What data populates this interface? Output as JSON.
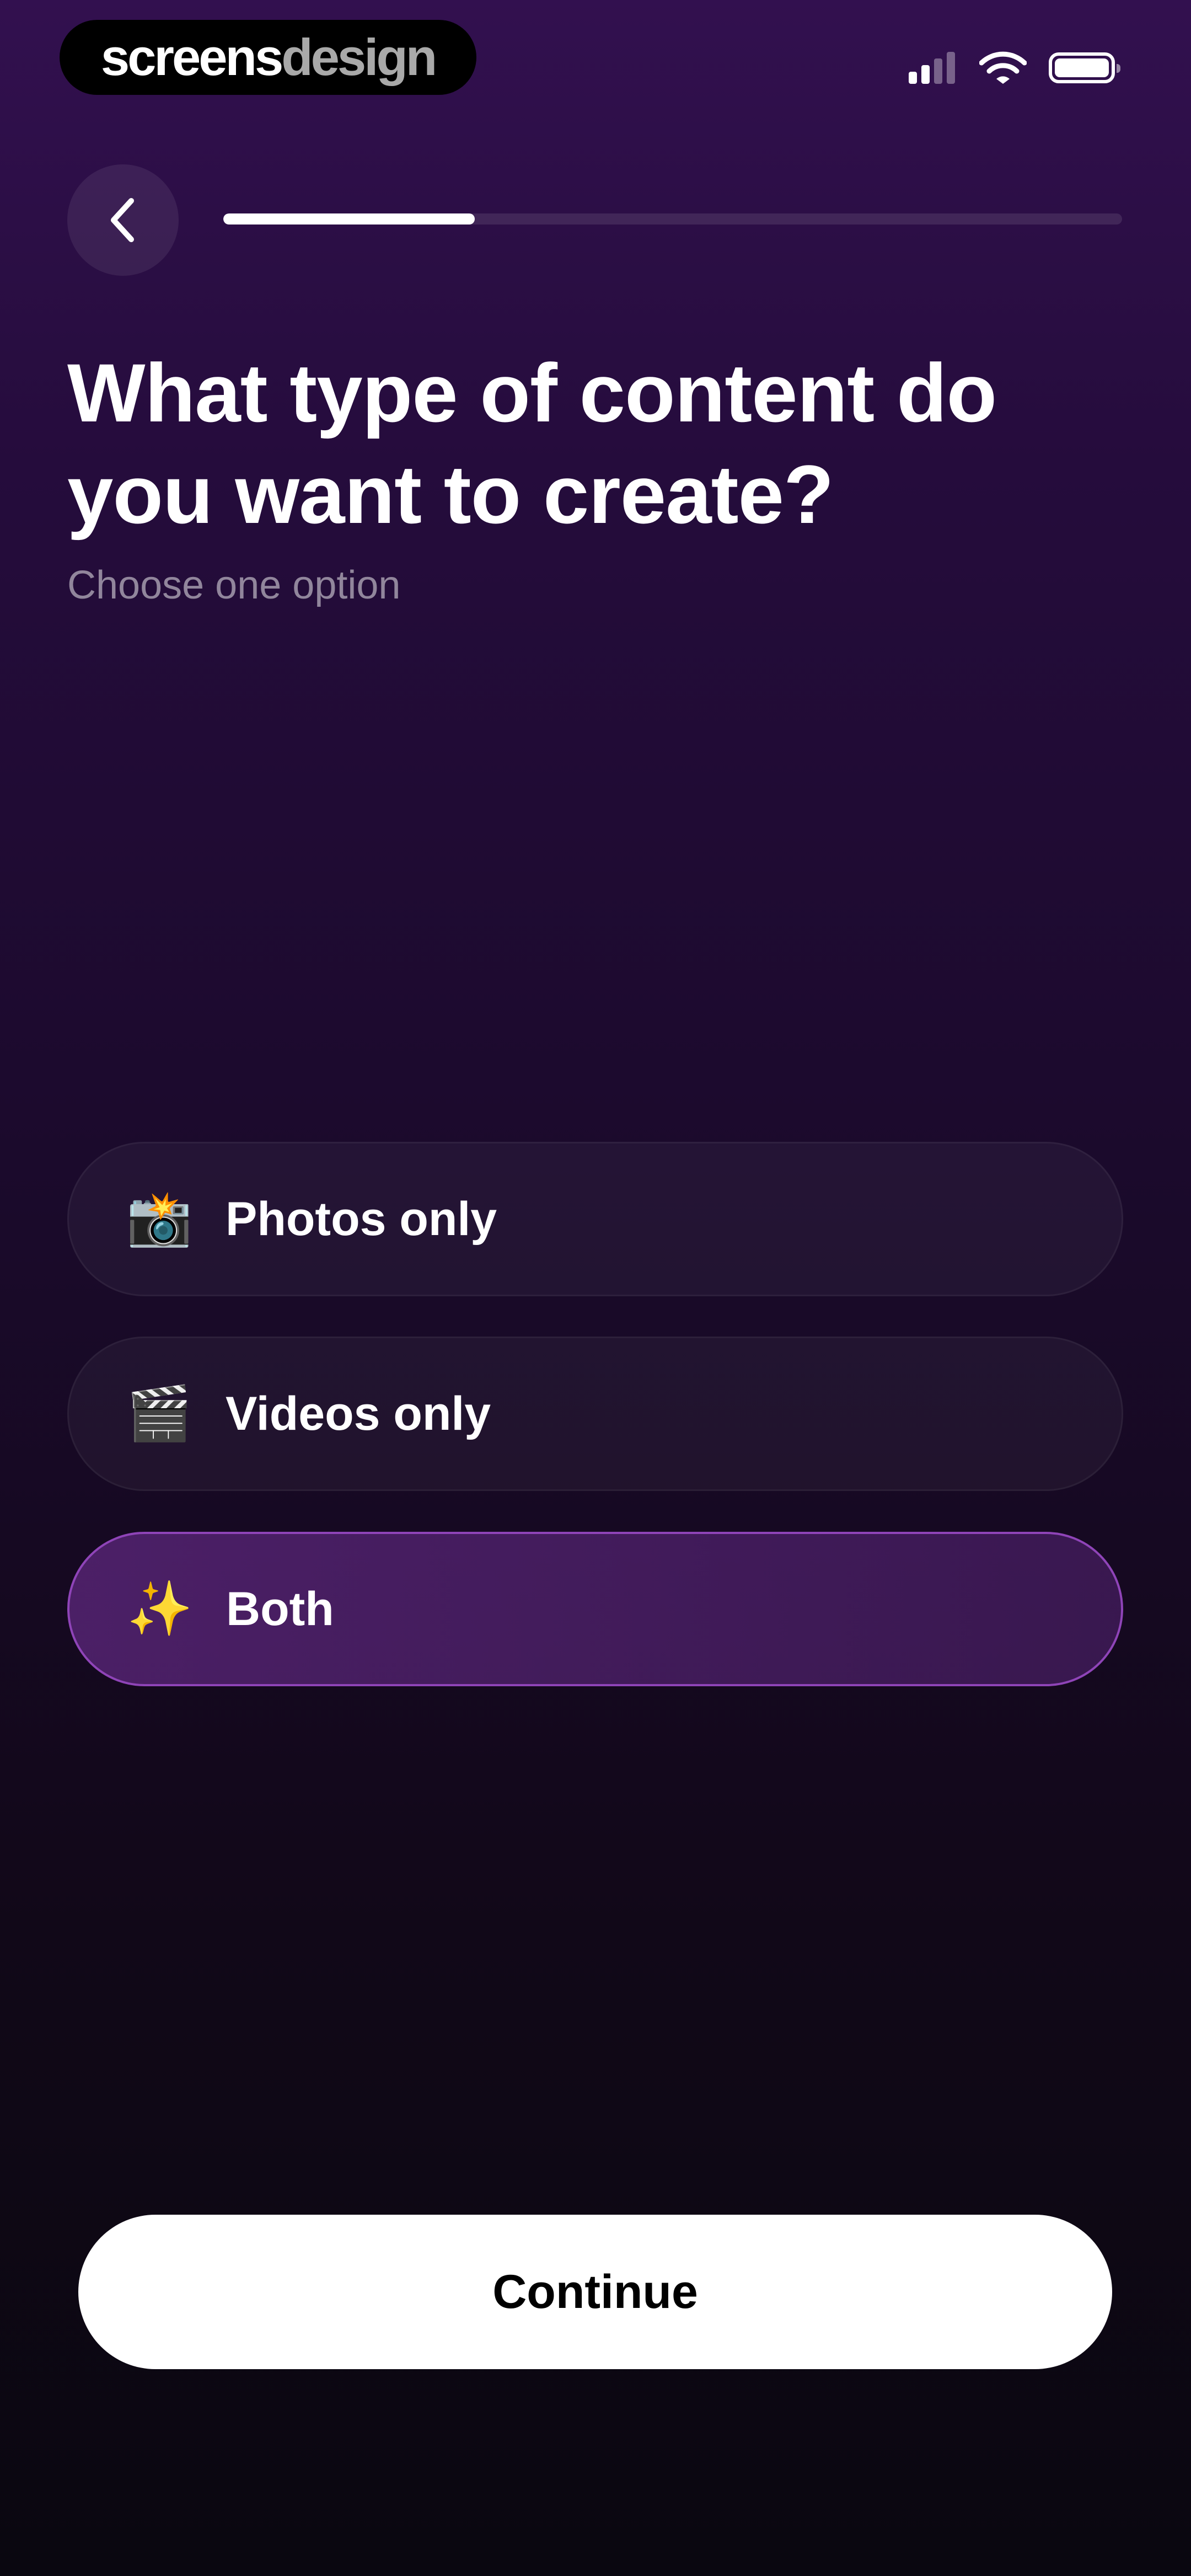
{
  "watermark": {
    "part1": "screens",
    "part2": "design"
  },
  "status_bar": {
    "signal_icon": "cellular-signal-icon",
    "wifi_icon": "wifi-icon",
    "battery_icon": "battery-icon"
  },
  "nav": {
    "back_icon": "chevron-left-icon",
    "progress_fraction": 0.28
  },
  "header": {
    "title": "What type of content do you want to create?",
    "subtitle": "Choose one option"
  },
  "options": [
    {
      "emoji": "📸",
      "icon": "camera-flash-icon",
      "label": "Photos only",
      "selected": false
    },
    {
      "emoji": "🎬",
      "icon": "clapper-board-icon",
      "label": "Videos only",
      "selected": false
    },
    {
      "emoji": "✨",
      "icon": "sparkles-icon",
      "label": "Both",
      "selected": true
    }
  ],
  "footer": {
    "continue_label": "Continue"
  },
  "colors": {
    "background_top": "#32104f",
    "background_bottom": "#0a0710",
    "selected_border": "#8f44b8",
    "button_background": "#ffffff",
    "button_text": "#000000"
  }
}
